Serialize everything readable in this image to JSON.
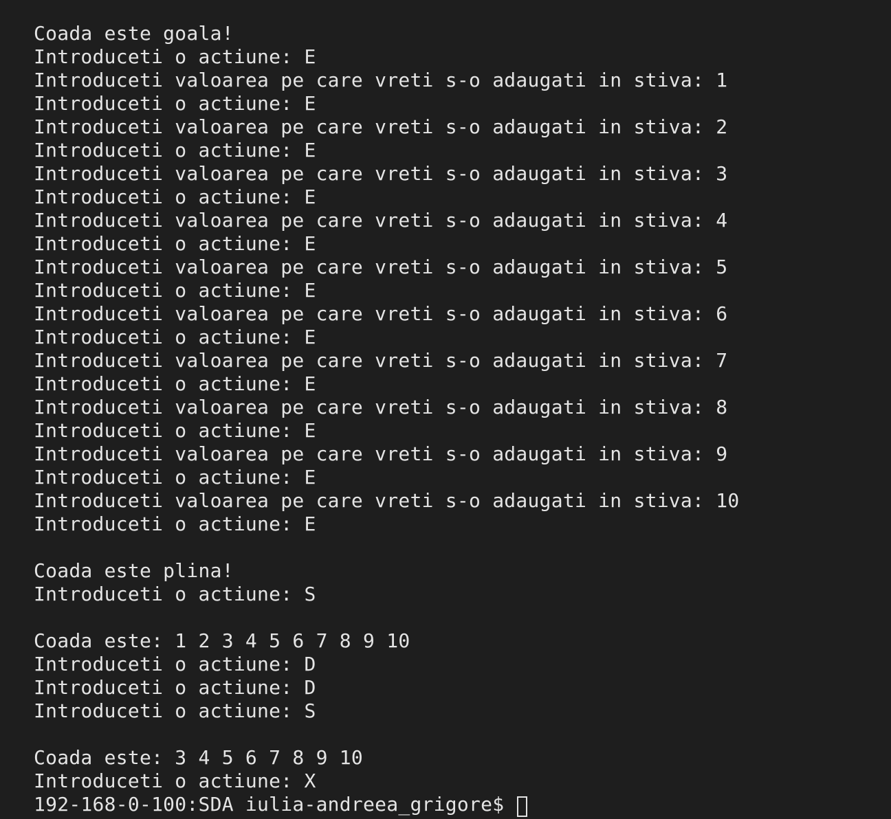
{
  "terminal": {
    "lines": [
      "Coada este goala!",
      "Introduceti o actiune: E",
      "Introduceti valoarea pe care vreti s-o adaugati in stiva: 1",
      "Introduceti o actiune: E",
      "Introduceti valoarea pe care vreti s-o adaugati in stiva: 2",
      "Introduceti o actiune: E",
      "Introduceti valoarea pe care vreti s-o adaugati in stiva: 3",
      "Introduceti o actiune: E",
      "Introduceti valoarea pe care vreti s-o adaugati in stiva: 4",
      "Introduceti o actiune: E",
      "Introduceti valoarea pe care vreti s-o adaugati in stiva: 5",
      "Introduceti o actiune: E",
      "Introduceti valoarea pe care vreti s-o adaugati in stiva: 6",
      "Introduceti o actiune: E",
      "Introduceti valoarea pe care vreti s-o adaugati in stiva: 7",
      "Introduceti o actiune: E",
      "Introduceti valoarea pe care vreti s-o adaugati in stiva: 8",
      "Introduceti o actiune: E",
      "Introduceti valoarea pe care vreti s-o adaugati in stiva: 9",
      "Introduceti o actiune: E",
      "Introduceti valoarea pe care vreti s-o adaugati in stiva: 10",
      "Introduceti o actiune: E",
      "",
      "Coada este plina!",
      "Introduceti o actiune: S",
      "",
      "Coada este: 1 2 3 4 5 6 7 8 9 10",
      "Introduceti o actiune: D",
      "Introduceti o actiune: D",
      "Introduceti o actiune: S",
      "",
      "Coada este: 3 4 5 6 7 8 9 10",
      "Introduceti o actiune: X"
    ],
    "prompt": "192-168-0-100:SDA iulia-andreea_grigore$ "
  },
  "colors": {
    "background": "#1e1e1e",
    "text": "#e4e4e4"
  }
}
